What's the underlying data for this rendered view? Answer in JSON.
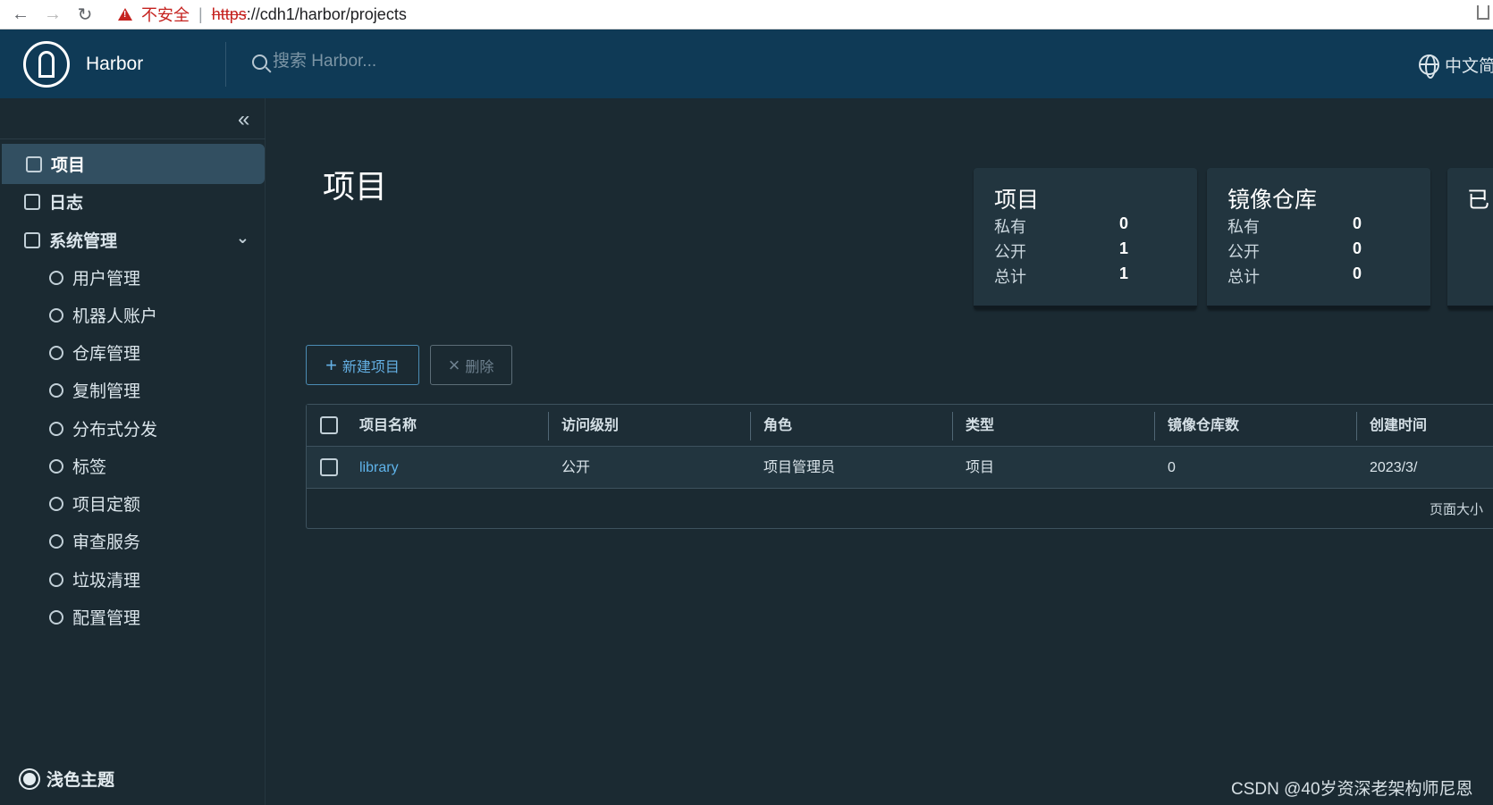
{
  "browser": {
    "back_label": "←",
    "forward_label": "→",
    "reload_label": "↻",
    "insecure_label": "不安全",
    "separator": "|",
    "url_scheme": "https",
    "url_rest": "://cdh1/harbor/projects"
  },
  "header": {
    "brand": "Harbor",
    "search_placeholder": "搜索 Harbor...",
    "language": "中文简体"
  },
  "sidebar": {
    "collapse_icon": "«",
    "items": [
      {
        "label": "项目",
        "active": true
      },
      {
        "label": "日志"
      },
      {
        "label": "系统管理",
        "expandable": true
      },
      {
        "label": "用户管理"
      },
      {
        "label": "机器人账户"
      },
      {
        "label": "仓库管理"
      },
      {
        "label": "复制管理"
      },
      {
        "label": "分布式分发"
      },
      {
        "label": "标签"
      },
      {
        "label": "项目定额"
      },
      {
        "label": "审查服务"
      },
      {
        "label": "垃圾清理"
      },
      {
        "label": "配置管理"
      }
    ],
    "theme_toggle": "浅色主题"
  },
  "main": {
    "title": "项目",
    "cards": [
      {
        "title": "项目",
        "rows": [
          {
            "label": "私有",
            "value": "0"
          },
          {
            "label": "公开",
            "value": "1"
          },
          {
            "label": "总计",
            "value": "1"
          }
        ]
      },
      {
        "title": "镜像仓库",
        "rows": [
          {
            "label": "私有",
            "value": "0"
          },
          {
            "label": "公开",
            "value": "0"
          },
          {
            "label": "总计",
            "value": "0"
          }
        ]
      },
      {
        "title": "已"
      }
    ],
    "buttons": {
      "add": "新建项目",
      "delete": "删除"
    },
    "table": {
      "columns": [
        "项目名称",
        "访问级别",
        "角色",
        "类型",
        "镜像仓库数",
        "创建时间"
      ],
      "rows": [
        {
          "name": "library",
          "access": "公开",
          "role": "项目管理员",
          "type": "项目",
          "repos": "0",
          "created": "2023/3/"
        }
      ],
      "footer": "页面大小"
    }
  },
  "watermark": "CSDN @40岁资深老架构师尼恩",
  "colors": {
    "header": "#0f3a56",
    "background": "#1b2a32",
    "accent": "#5fb3ea",
    "active_nav": "#324f61"
  }
}
